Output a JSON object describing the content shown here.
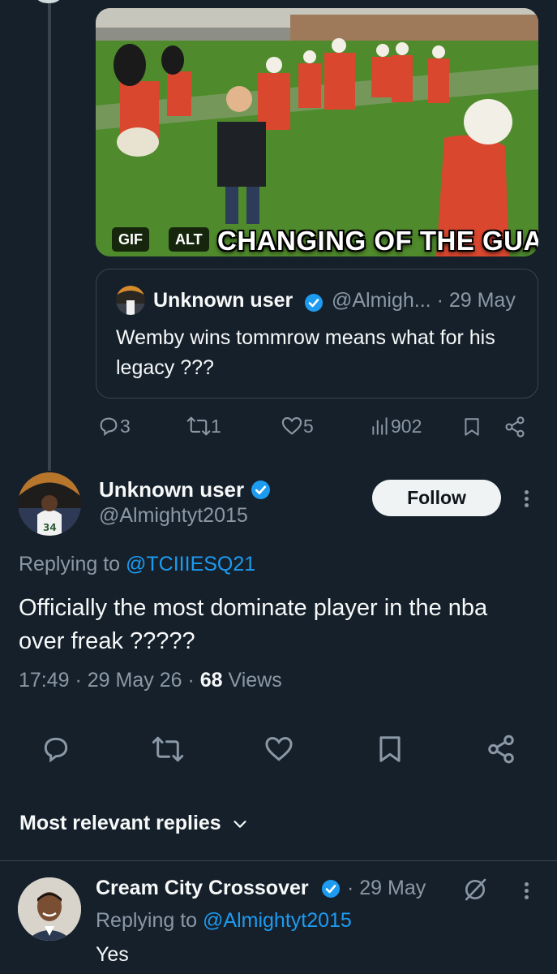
{
  "thread": {
    "media": {
      "caption": "CHANGING OF THE GUARD!",
      "gif_badge": "GIF",
      "alt_badge": "ALT"
    },
    "quoted_tweet": {
      "name": "Unknown user",
      "handle_date": "@Almigh... · 29 May",
      "text": "Wemby wins tommrow means what for his legacy ???"
    },
    "actions": {
      "replies": "3",
      "reposts": "1",
      "likes": "5",
      "views": "902"
    }
  },
  "main_tweet": {
    "name": "Unknown user",
    "handle": "@Almightyt2015",
    "follow_label": "Follow",
    "replying_prefix": "Replying to",
    "replying_handle": "@TCIIIESQ21",
    "text": "Officially the most dominate player in the nba over freak ?????",
    "time_date": "17:49 · 29 May 26 · ",
    "views_count": "68",
    "views_label": " Views"
  },
  "sort": {
    "label": "Most relevant replies"
  },
  "reply": {
    "name": "Cream City Crossover",
    "date": "· 29 May",
    "replying_prefix": "Replying to",
    "replying_handle": "@Almightyt2015",
    "text": "Yes"
  },
  "colors": {
    "background": "#15202b",
    "text": "#f7f9f9",
    "muted": "#8b98a5",
    "link": "#1d9bf0",
    "verified": "#1d9bf0",
    "border": "#38444d"
  },
  "icons": [
    "verified-badge-icon",
    "reply-icon",
    "repost-icon",
    "like-icon",
    "views-icon",
    "bookmark-icon",
    "share-icon",
    "more-icon",
    "chevron-down-icon",
    "grok-icon"
  ]
}
